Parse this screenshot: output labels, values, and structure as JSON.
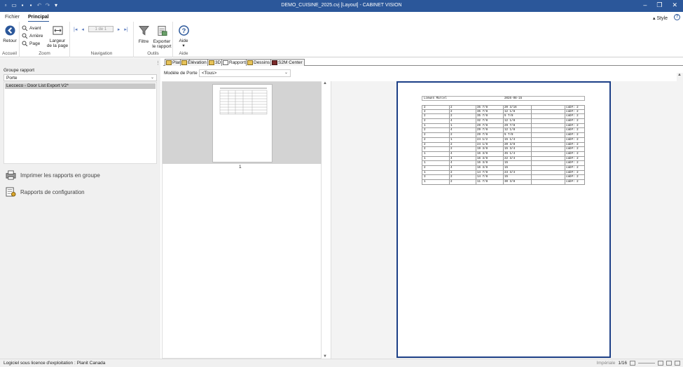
{
  "window": {
    "title": "DEMO_CUISINE_2025.cvj [Layout] - CABINET VISION"
  },
  "tabs": {
    "file": "Fichier",
    "main": "Principal"
  },
  "style_label": "Style",
  "ribbon": {
    "retour": "Retour",
    "avant": "Avant",
    "arriere": "Arrière",
    "page": "Page",
    "largeur_1": "Largeur",
    "largeur_2": "de la page",
    "page_box": "1 de 1",
    "filtre": "Filtre",
    "exporter_1": "Exporter",
    "exporter_2": "le rapport",
    "aide": "Aide",
    "groups": {
      "accueil": "Accueil",
      "zoom": "Zoom",
      "navigation": "Navigation",
      "outils": "Outils",
      "aide": "Aide"
    }
  },
  "left_panel": {
    "groupe_label": "Groupe rapport",
    "groupe_value": "Porte",
    "list_items": [
      "Lecceco - Door List Export V2*"
    ],
    "print_group": "Imprimer les rapports en groupe",
    "config_reports": "Rapports de configuration"
  },
  "doc_tabs": [
    "Plan",
    "Élévation",
    "3D",
    "Rapports",
    "Dessins",
    "S2M Center"
  ],
  "main": {
    "model_label": "Modèle de Porte",
    "model_value": "<Tous>",
    "thumb_page_number": "1"
  },
  "report": {
    "header_name": "Loewen Marcel",
    "header_date": "2026-08-15",
    "rows": [
      [
        "2",
        "2",
        "35 7/8",
        "20 3/16",
        "cab#: 2"
      ],
      [
        "2",
        "2",
        "35 7/8",
        "12 1/8",
        "cab#: 2"
      ],
      [
        "2",
        "2",
        "35 7/8",
        "5 7/8",
        "cab#: 2"
      ],
      [
        "2",
        "4",
        "32 7/8",
        "12 1/8",
        "cab#: 2"
      ],
      [
        "1",
        "1",
        "29 7/8",
        "29 7/8",
        "cab#: 2"
      ],
      [
        "2",
        "4",
        "29 7/8",
        "12 1/8",
        "cab#: 2"
      ],
      [
        "2",
        "2",
        "29 7/8",
        "5 7/8",
        "cab#: 2"
      ],
      [
        "2",
        "1",
        "24 1/2",
        "15 1/4",
        "cab#: 2"
      ],
      [
        "2",
        "2",
        "24 1/8",
        "20 3/8",
        "cab#: 2"
      ],
      [
        "2",
        "2",
        "19 3/8",
        "15 3/4",
        "cab#: 2"
      ],
      [
        "1",
        "4",
        "16 3/8",
        "45 1/4",
        "cab#: 2"
      ],
      [
        "1",
        "4",
        "16 3/8",
        "22 3/4",
        "cab#: 2"
      ],
      [
        "1",
        "4",
        "16 3/8",
        "15",
        "cab#: 2"
      ],
      [
        "2",
        "4",
        "16 3/8",
        "15",
        "cab#: 2"
      ],
      [
        "1",
        "2",
        "14 7/8",
        "23 3/4",
        "cab#: 2"
      ],
      [
        "3",
        "2",
        "14 7/8",
        "15",
        "cab#: 2"
      ],
      [
        "1",
        "2",
        "11 7/8",
        "30 3/8",
        "cab#: 2"
      ]
    ]
  },
  "status": {
    "license": "Logiciel sous licence d'exploitation : Planit Canada",
    "units": "Impériale",
    "pages": "1/16"
  }
}
